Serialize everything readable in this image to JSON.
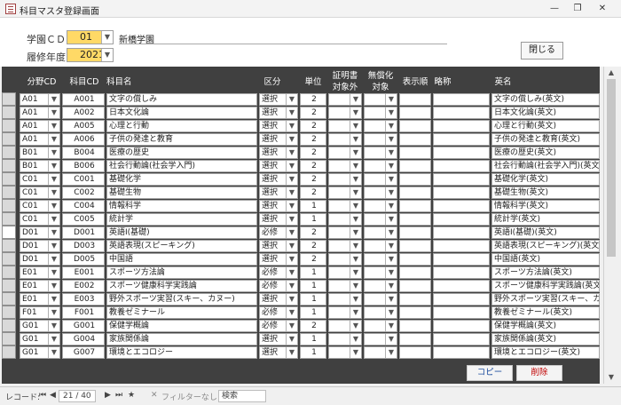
{
  "window": {
    "title": "科目マスタ登録画面"
  },
  "header": {
    "school_cd_label": "学園ＣＤ",
    "school_cd_value": "01",
    "school_name": "新橋学園",
    "year_label": "履修年度",
    "year_value": "2021",
    "close_label": "閉じる"
  },
  "columns": {
    "field_cd": "分野CD",
    "subject_cd": "科目CD",
    "subject_name": "科目名",
    "category": "区分",
    "credits": "単位",
    "cert_line1": "証明書",
    "cert_line2": "対象外",
    "free_line1": "無償化",
    "free_line2": "対象",
    "display_order": "表示順",
    "abbrev": "略称",
    "english_name": "英名"
  },
  "rows": [
    {
      "field": "A01",
      "code": "A001",
      "name": "文字の償しみ",
      "cat": "選択",
      "credits": "2",
      "en": "文字の償しみ(英文)"
    },
    {
      "field": "A01",
      "code": "A002",
      "name": "日本文化論",
      "cat": "選択",
      "credits": "2",
      "en": "日本文化論(英文)"
    },
    {
      "field": "A01",
      "code": "A005",
      "name": "心理と行動",
      "cat": "選択",
      "credits": "2",
      "en": "心理と行動(英文)"
    },
    {
      "field": "A01",
      "code": "A006",
      "name": "子供の発達と教育",
      "cat": "選択",
      "credits": "2",
      "en": "子供の発達と教育(英文)"
    },
    {
      "field": "B01",
      "code": "B004",
      "name": "医療の歴史",
      "cat": "選択",
      "credits": "2",
      "en": "医療の歴史(英文)"
    },
    {
      "field": "B01",
      "code": "B006",
      "name": "社会行動論(社会学入門)",
      "cat": "選択",
      "credits": "2",
      "en": "社会行動論(社会学入門)(英文"
    },
    {
      "field": "C01",
      "code": "C001",
      "name": "基礎化学",
      "cat": "選択",
      "credits": "2",
      "en": "基礎化学(英文)"
    },
    {
      "field": "C01",
      "code": "C002",
      "name": "基礎生物",
      "cat": "選択",
      "credits": "2",
      "en": "基礎生物(英文)"
    },
    {
      "field": "C01",
      "code": "C004",
      "name": "情報科学",
      "cat": "選択",
      "credits": "1",
      "en": "情報科学(英文)"
    },
    {
      "field": "C01",
      "code": "C005",
      "name": "統計学",
      "cat": "選択",
      "credits": "1",
      "en": "統計学(英文)"
    },
    {
      "field": "D01",
      "code": "D001",
      "name": "英語Ⅰ(基礎)",
      "cat": "必修",
      "credits": "2",
      "en": "英語Ⅰ(基礎)(英文)"
    },
    {
      "field": "D01",
      "code": "D003",
      "name": "英語表現(スピーキング)",
      "cat": "選択",
      "credits": "2",
      "en": "英語表現(スピーキング)(英文"
    },
    {
      "field": "D01",
      "code": "D005",
      "name": "中国語",
      "cat": "選択",
      "credits": "2",
      "en": "中国語(英文)"
    },
    {
      "field": "E01",
      "code": "E001",
      "name": "スポーツ方法論",
      "cat": "必修",
      "credits": "1",
      "en": "スポーツ方法論(英文)"
    },
    {
      "field": "E01",
      "code": "E002",
      "name": "スポーツ健康科学実践論",
      "cat": "必修",
      "credits": "1",
      "en": "スポーツ健康科学実践論(英文"
    },
    {
      "field": "E01",
      "code": "E003",
      "name": "野外スポーツ実習(スキー、カヌー)",
      "cat": "選択",
      "credits": "1",
      "en": "野外スポーツ実習(スキー、カヌ"
    },
    {
      "field": "F01",
      "code": "F001",
      "name": "教養ゼミナール",
      "cat": "必修",
      "credits": "1",
      "en": "教養ゼミナール(英文)"
    },
    {
      "field": "G01",
      "code": "G001",
      "name": "保健学概論",
      "cat": "必修",
      "credits": "2",
      "en": "保健学概論(英文)"
    },
    {
      "field": "G01",
      "code": "G004",
      "name": "家族関係論",
      "cat": "選択",
      "credits": "1",
      "en": "家族関係論(英文)"
    },
    {
      "field": "G01",
      "code": "G007",
      "name": "環境とエコロジー",
      "cat": "選択",
      "credits": "1",
      "en": "環境とエコロジー(英文)"
    }
  ],
  "selected_row": 10,
  "actions": {
    "copy_label": "コピー",
    "delete_label": "削除"
  },
  "record_nav": {
    "label": "レコード:",
    "position": "21 / 40",
    "filter": "フィルターなし",
    "search": "検索"
  },
  "colors": {
    "combo_bg": "#ffd966",
    "grid_bg": "#404040",
    "delete_text": "#c00000",
    "copy_text": "#1f4fa0"
  }
}
